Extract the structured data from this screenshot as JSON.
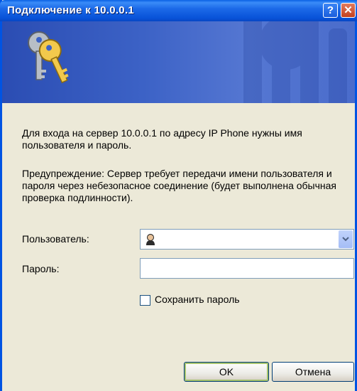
{
  "window": {
    "title": "Подключение к 10.0.0.1",
    "help_glyph": "?",
    "close_glyph": "✕",
    "title_bar_color": "#0A58E0",
    "banner_color": "#3C62C6"
  },
  "banner": {
    "icon": "keys-icon",
    "watermark_icon": "keys-watermark-icon"
  },
  "message": {
    "line1": "Для входа на сервер 10.0.0.1 по адресу IP Phone нужны имя пользователя и пароль.",
    "line2": "Предупреждение: Сервер требует передачи имени пользователя и пароля через небезопасное соединение (будет выполнена обычная проверка подлинности)."
  },
  "form": {
    "user_label": "Пользователь:",
    "user_value": "",
    "user_icon": "user-icon",
    "password_label": "Пароль:",
    "password_value": "",
    "save_password_label": "Сохранить пароль",
    "save_password_checked": false
  },
  "buttons": {
    "ok": "OK",
    "cancel": "Отмена"
  }
}
